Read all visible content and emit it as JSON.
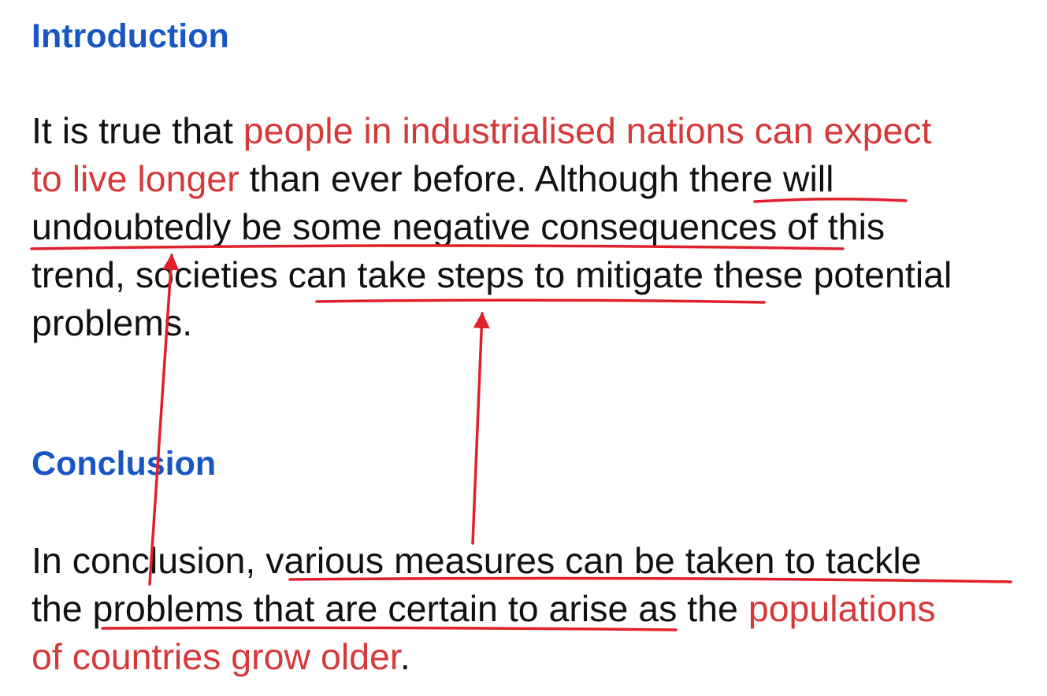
{
  "introduction": {
    "heading": "Introduction",
    "lines": [
      [
        {
          "text": "It is true that ",
          "style": "plain"
        },
        {
          "text": "people in industrialised nations can expect",
          "style": "red"
        }
      ],
      [
        {
          "text": "to live longer",
          "style": "red"
        },
        {
          "text": " than ever before. Although there will",
          "style": "plain"
        }
      ],
      [
        {
          "text": "undoubtedly be some negative consequences of this",
          "style": "plain"
        }
      ],
      [
        {
          "text": "trend, societies can take steps to mitigate these potential",
          "style": "plain"
        }
      ],
      [
        {
          "text": "problems.",
          "style": "plain"
        }
      ]
    ]
  },
  "conclusion": {
    "heading": "Conclusion",
    "lines": [
      [
        {
          "text": "In conclusion, various measures can be taken to tackle",
          "style": "plain"
        }
      ],
      [
        {
          "text": "the problems that are certain to arise as the ",
          "style": "plain"
        },
        {
          "text": "populations",
          "style": "red"
        }
      ],
      [
        {
          "text": "of countries grow older",
          "style": "red"
        },
        {
          "text": ".",
          "style": "plain"
        }
      ]
    ]
  },
  "annotation_color": "#e0202a",
  "highlight_color": "#d53939",
  "heading_color": "#1756c4"
}
